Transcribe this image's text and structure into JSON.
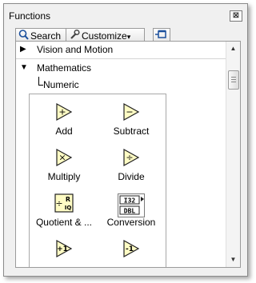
{
  "window": {
    "title": "Functions",
    "close_glyph": "⊠"
  },
  "toolbar": {
    "search_label": "Search",
    "customize_label": "Customize",
    "customize_arrow": "▾"
  },
  "categories": [
    {
      "label": "Vision and Motion",
      "expanded": false,
      "arrow": "▶"
    },
    {
      "label": "Mathematics",
      "expanded": true,
      "arrow": "▼"
    }
  ],
  "subcategory": {
    "label": "Numeric"
  },
  "palette_items": [
    {
      "label": "Add",
      "glyph": "+",
      "icon": "add-vi-icon"
    },
    {
      "label": "Subtract",
      "glyph": "−",
      "icon": "subtract-vi-icon"
    },
    {
      "label": "Multiply",
      "glyph": "×",
      "icon": "multiply-vi-icon"
    },
    {
      "label": "Divide",
      "glyph": "÷",
      "icon": "divide-vi-icon"
    },
    {
      "label": "Quotient & ...",
      "glyph": "÷",
      "icon": "quotient-remainder-icon",
      "sub_r": "R",
      "sub_iq": "IQ"
    },
    {
      "label": "Conversion",
      "glyph": "",
      "icon": "conversion-icon",
      "top_text": "I32",
      "bottom_text": "DBL"
    },
    {
      "label": "",
      "glyph": "+1",
      "icon": "increment-vi-icon"
    },
    {
      "label": "",
      "glyph": "-1",
      "icon": "decrement-vi-icon"
    }
  ],
  "colors": {
    "vi_fill": "#fffcc4",
    "vi_stroke": "#202020"
  }
}
